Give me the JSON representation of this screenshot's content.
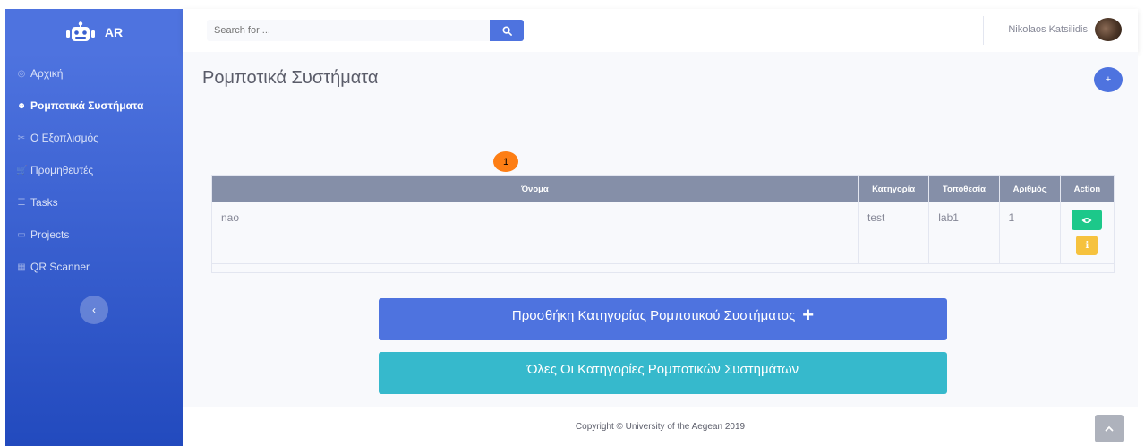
{
  "sidebar": {
    "brand": {
      "icon": "robot-icon",
      "label": "AR"
    },
    "items": [
      {
        "icon": "dashboard-icon",
        "glyph": "◎",
        "label": "Αρχική",
        "active": false
      },
      {
        "icon": "robot-icon",
        "glyph": "☻",
        "label": "Ρομποτικά Συστήματα",
        "active": true
      },
      {
        "icon": "tools-icon",
        "glyph": "✂",
        "label": "Ο Εξοπλισμός",
        "active": false
      },
      {
        "icon": "cart-icon",
        "glyph": "🛒",
        "label": "Προμηθευτές",
        "active": false
      },
      {
        "icon": "list-icon",
        "glyph": "☰",
        "label": "Tasks",
        "active": false
      },
      {
        "icon": "folder-icon",
        "glyph": "▭",
        "label": "Projects",
        "active": false
      },
      {
        "icon": "qrcode-icon",
        "glyph": "▦",
        "label": "QR Scanner",
        "active": false
      }
    ],
    "toggle_glyph": "‹"
  },
  "topbar": {
    "search_placeholder": "Search for ...",
    "user_name": "Nikolaos Katsilidis"
  },
  "main": {
    "title": "Ρομποτικά Συστήματα",
    "add_glyph": "+",
    "badge": "1",
    "table": {
      "headers": [
        "Όνομα",
        "Κατηγορία",
        "Τοποθεσία",
        "Αριθμός",
        "Action"
      ],
      "rows": [
        {
          "name": "nao",
          "category": "test",
          "location": "lab1",
          "number": "1"
        }
      ]
    },
    "buttons": {
      "add_category": "Προσθήκη Κατηγορίας Ρομποτικού Συστήματος",
      "all_categories": "Όλες Οι Κατηγορίες Ρομποτικών Συστημάτων"
    }
  },
  "footer": {
    "copyright": "Copyright © University of the Aegean 2019"
  },
  "colors": {
    "primary": "#4e73df",
    "info": "#36b9cc",
    "success": "#1cc88a",
    "warning": "#f6c23e",
    "badge": "#fd7e14"
  }
}
